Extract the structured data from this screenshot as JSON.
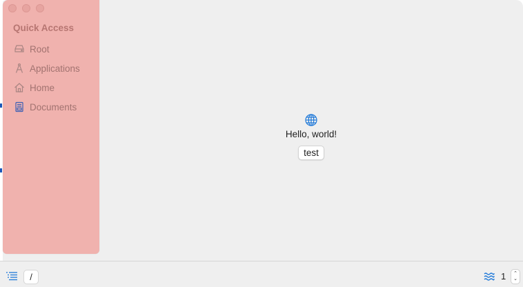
{
  "sidebar": {
    "heading": "Quick Access",
    "items": [
      {
        "label": "Root",
        "icon": "drive-icon"
      },
      {
        "label": "Applications",
        "icon": "applications-icon"
      },
      {
        "label": "Home",
        "icon": "home-icon"
      },
      {
        "label": "Documents",
        "icon": "documents-icon"
      }
    ]
  },
  "main": {
    "icon": "globe-icon",
    "greeting": "Hello, world!",
    "button_label": "test"
  },
  "bottom_bar": {
    "path_value": "/",
    "stepper_value": "1",
    "stepper_up": "⌃",
    "stepper_down": "⌄"
  },
  "colors": {
    "sidebar_bg": "#f0b2ae",
    "accent": "#1e78d8",
    "window_bg": "#efefef"
  }
}
